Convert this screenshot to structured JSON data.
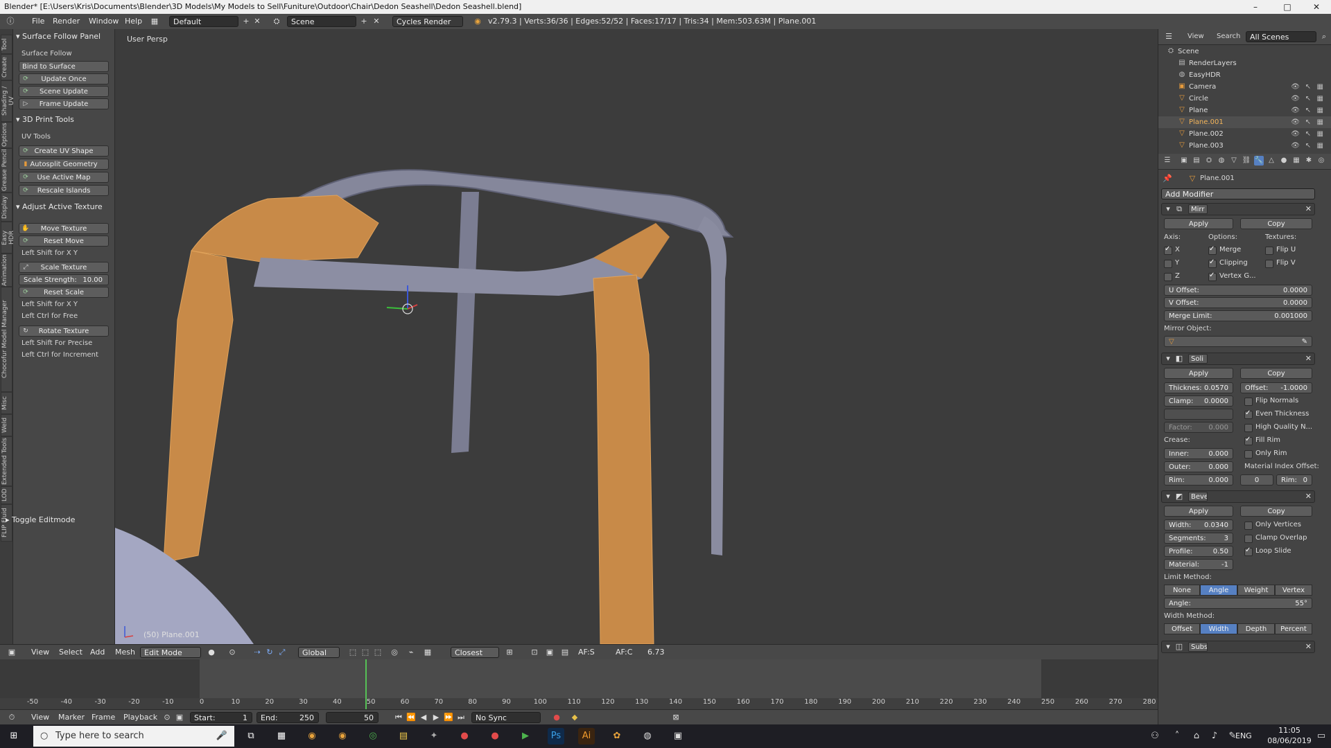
{
  "window": {
    "title": "Blender* [E:\\Users\\Kris\\Documents\\Blender\\3D Models\\My Models to Sell\\Funiture\\Outdoor\\Chair\\Dedon Seashell\\Dedon Seashell.blend]",
    "minimize": "–",
    "maximize": "□",
    "close": "✕"
  },
  "infobar": {
    "menus": [
      "File",
      "Render",
      "Window",
      "Help"
    ],
    "layout": "Default",
    "scene": "Scene",
    "engine": "Cycles Render",
    "stats": "v2.79.3 | Verts:36/36 | Edges:52/52 | Faces:17/17 | Tris:34 | Mem:503.63M | Plane.001"
  },
  "vtabs": [
    "Tool",
    "Create",
    "Shading / UV",
    "Options",
    "Grease Pencil",
    "Display",
    "Easy HDR",
    "Animation",
    "Chocofur Model Manager",
    "Misc",
    "Weld",
    "Extended Tools",
    "LOD",
    "FLIP Fluid"
  ],
  "toolshelf": {
    "surface_panel": {
      "title": "Surface Follow Panel",
      "section": "Surface Follow",
      "bind": "Bind to Surface",
      "buttons": [
        "Update Once",
        "Scene Update",
        "Frame Update"
      ]
    },
    "print_panel": {
      "title": "3D Print Tools",
      "section": "UV Tools",
      "buttons": [
        "Create UV Shape",
        "Autosplit Geometry",
        "Use Active Map",
        "Rescale Islands"
      ]
    },
    "adjust_panel": {
      "title": "Adjust Active Texture",
      "move": "Move Texture",
      "reset_move": "Reset Move",
      "shift_hint": "Left Shift for X Y",
      "scale": "Scale Texture",
      "strength_label": "Scale Strength:",
      "strength_value": "10.00",
      "reset_scale": "Reset Scale",
      "shift_hint2": "Left Shift for X Y",
      "ctrl_hint": "Left Ctrl for Free",
      "rotate": "Rotate Texture",
      "precise_hint": "Left Shift For Precise",
      "increment_hint": "Left Ctrl for Increment"
    },
    "toggle": "Toggle Editmode"
  },
  "viewport": {
    "label": "User Persp",
    "object_label": "(50) Plane.001"
  },
  "vheader": {
    "menus": [
      "View",
      "Select",
      "Add",
      "Mesh"
    ],
    "mode": "Edit Mode",
    "orientation": "Global",
    "snap": "Closest",
    "afs": "AF:S",
    "afc": "AF:C",
    "value": "6.73"
  },
  "timeline": {
    "ticks": [
      -50,
      -40,
      -30,
      -20,
      -10,
      0,
      10,
      20,
      30,
      40,
      50,
      60,
      70,
      80,
      90,
      100,
      110,
      120,
      130,
      140,
      150,
      160,
      170,
      180,
      190,
      200,
      210,
      220,
      230,
      240,
      250,
      260,
      270,
      280
    ],
    "current_frame": 50,
    "menus": [
      "View",
      "Marker",
      "Frame",
      "Playback"
    ],
    "start_label": "Start:",
    "start": "1",
    "end_label": "End:",
    "end": "250",
    "frame": "50",
    "sync": "No Sync"
  },
  "outliner": {
    "menus": [
      "View",
      "Search"
    ],
    "filter": "All Scenes",
    "rows": [
      {
        "name": "Scene",
        "icon": "scene-icon"
      },
      {
        "name": "RenderLayers",
        "icon": "render-layers-icon"
      },
      {
        "name": "EasyHDR",
        "icon": "world-icon"
      },
      {
        "name": "Camera",
        "icon": "camera-icon"
      },
      {
        "name": "Circle",
        "icon": "mesh-icon"
      },
      {
        "name": "Plane",
        "icon": "mesh-icon"
      },
      {
        "name": "Plane.001",
        "icon": "mesh-icon"
      },
      {
        "name": "Plane.002",
        "icon": "mesh-icon"
      },
      {
        "name": "Plane.003",
        "icon": "mesh-icon"
      }
    ]
  },
  "properties": {
    "object": "Plane.001",
    "add_modifier": "Add Modifier",
    "mirror": {
      "name": "Mirr",
      "apply": "Apply",
      "copy": "Copy",
      "axis": "Axis:",
      "options": "Options:",
      "textures": "Textures:",
      "x": "X",
      "y": "Y",
      "z": "Z",
      "merge": "Merge",
      "clipping": "Clipping",
      "vertex": "Vertex G...",
      "flip_u": "Flip U",
      "flip_v": "Flip V",
      "u_offset": "U Offset:",
      "u_offset_val": "0.0000",
      "v_offset": "V Offset:",
      "v_offset_val": "0.0000",
      "merge_limit": "Merge Limit:",
      "merge_limit_val": "0.001000",
      "mirror_object": "Mirror Object:"
    },
    "solidify": {
      "name": "Soli",
      "apply": "Apply",
      "copy": "Copy",
      "thickness": "Thicknes:",
      "thickness_val": "0.0570",
      "offset": "Offset:",
      "offset_val": "-1.0000",
      "clamp": "Clamp:",
      "clamp_val": "0.0000",
      "factor": "Factor:",
      "factor_val": "0.000",
      "flip_normals": "Flip Normals",
      "even": "Even Thickness",
      "hq": "High Quality N...",
      "fill_rim": "Fill Rim",
      "only_rim": "Only Rim",
      "crease": "Crease:",
      "inner": "Inner:",
      "inner_val": "0.000",
      "outer": "Outer:",
      "outer_val": "0.000",
      "rim": "Rim:",
      "rim_val": "0.000",
      "mat_index": "Material Index Offset:",
      "mat_val": "0",
      "rim2": "Rim:",
      "rim2_val": "0"
    },
    "bevel": {
      "name": "Beve",
      "apply": "Apply",
      "copy": "Copy",
      "width": "Width:",
      "width_val": "0.0340",
      "segments": "Segments:",
      "segments_val": "3",
      "profile": "Profile:",
      "profile_val": "0.50",
      "material": "Material:",
      "material_val": "-1",
      "only_vertices": "Only Vertices",
      "clamp": "Clamp Overlap",
      "loop": "Loop Slide",
      "limit_method": "Limit Method:",
      "limit_opts": [
        "None",
        "Angle",
        "Weight",
        "Vertex G..."
      ],
      "angle": "Angle:",
      "angle_val": "55°",
      "width_method": "Width Method:",
      "width_opts": [
        "Offset",
        "Width",
        "Depth",
        "Percent"
      ]
    },
    "subsurf": {
      "name": "Subs"
    }
  },
  "taskbar": {
    "search_placeholder": "Type here to search",
    "lang": "ENG",
    "time": "11:05",
    "date": "08/06/2019"
  },
  "colors": {
    "selected_face": "#c88a48",
    "mesh_gray": "#7e8096",
    "accent_blue": "#5680c2"
  }
}
